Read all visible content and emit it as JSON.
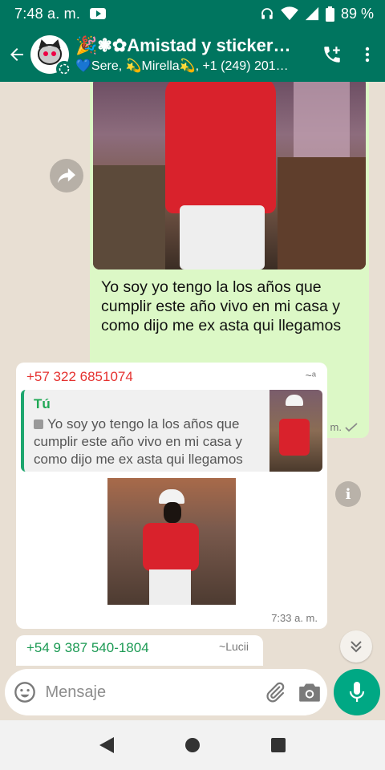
{
  "status_bar": {
    "time": "7:48 a. m.",
    "battery": "89 %"
  },
  "header": {
    "title": "🎉❃✿Amistad y stickers…",
    "subtitle": "💙Sere, 💫Mirella💫, +1 (249) 201…"
  },
  "messages": {
    "outgoing": {
      "text": "Yo soy yo tengo la los años que cumplir este año vivo en mi casa y como dijo me ex asta qui llegamos",
      "time": "7:33 a. m.",
      "status": "sent"
    },
    "reply": {
      "sender": "+57 322 6851074",
      "sender_pushname": "~ᵃ",
      "quote_author": "Tú",
      "quote_text": "Yo soy yo tengo la los años que cumplir este año vivo en mi casa y como dijo me ex asta qui llegamos",
      "time": "7:33 a. m."
    },
    "next": {
      "sender": "+54 9 387 540-1804",
      "sender_pushname": "~Lucii"
    }
  },
  "composer": {
    "placeholder": "Mensaje"
  },
  "colors": {
    "header": "#00755f",
    "outgoing_bubble": "#dcf8c6",
    "accent": "#00a884",
    "sender1": "#e5312f",
    "sender2": "#1c9a54"
  },
  "icons": [
    "back-arrow-icon",
    "group-avatar",
    "add-call-icon",
    "more-vert-icon",
    "forward-icon",
    "info-icon",
    "chevron-double-down-icon",
    "emoji-icon",
    "attach-icon",
    "camera-icon",
    "mic-icon",
    "nav-back-icon",
    "nav-home-icon",
    "nav-recents-icon"
  ]
}
